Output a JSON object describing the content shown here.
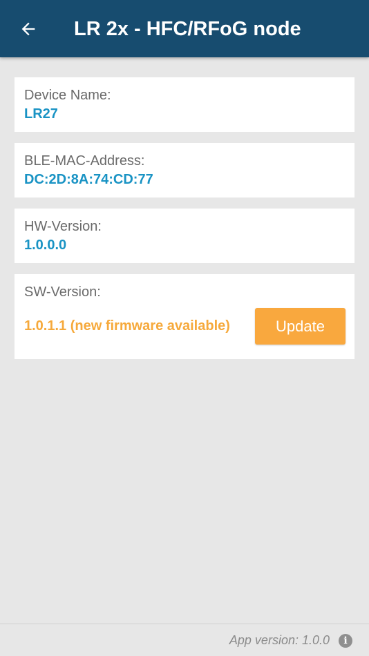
{
  "app_bar": {
    "back_icon": "arrow-left-icon",
    "title": "LR 2x - HFC/RFoG node",
    "background_color": "#174c6f"
  },
  "device_info": {
    "device_name": {
      "label": "Device Name:",
      "value": "LR27"
    },
    "ble_mac": {
      "label": "BLE-MAC-Address:",
      "value": "DC:2D:8A:74:CD:77"
    },
    "hw_version": {
      "label": "HW-Version:",
      "value": "1.0.0.0"
    },
    "sw_version": {
      "label": "SW-Version:",
      "value": "1.0.1.1 (new firmware available)",
      "update_label": "Update"
    }
  },
  "colors": {
    "value_blue": "#1993c4",
    "warning_orange": "#f6a93b",
    "update_button": "#f9a83e"
  },
  "footer": {
    "app_version": "App version: 1.0.0",
    "info_icon": "info-icon"
  }
}
